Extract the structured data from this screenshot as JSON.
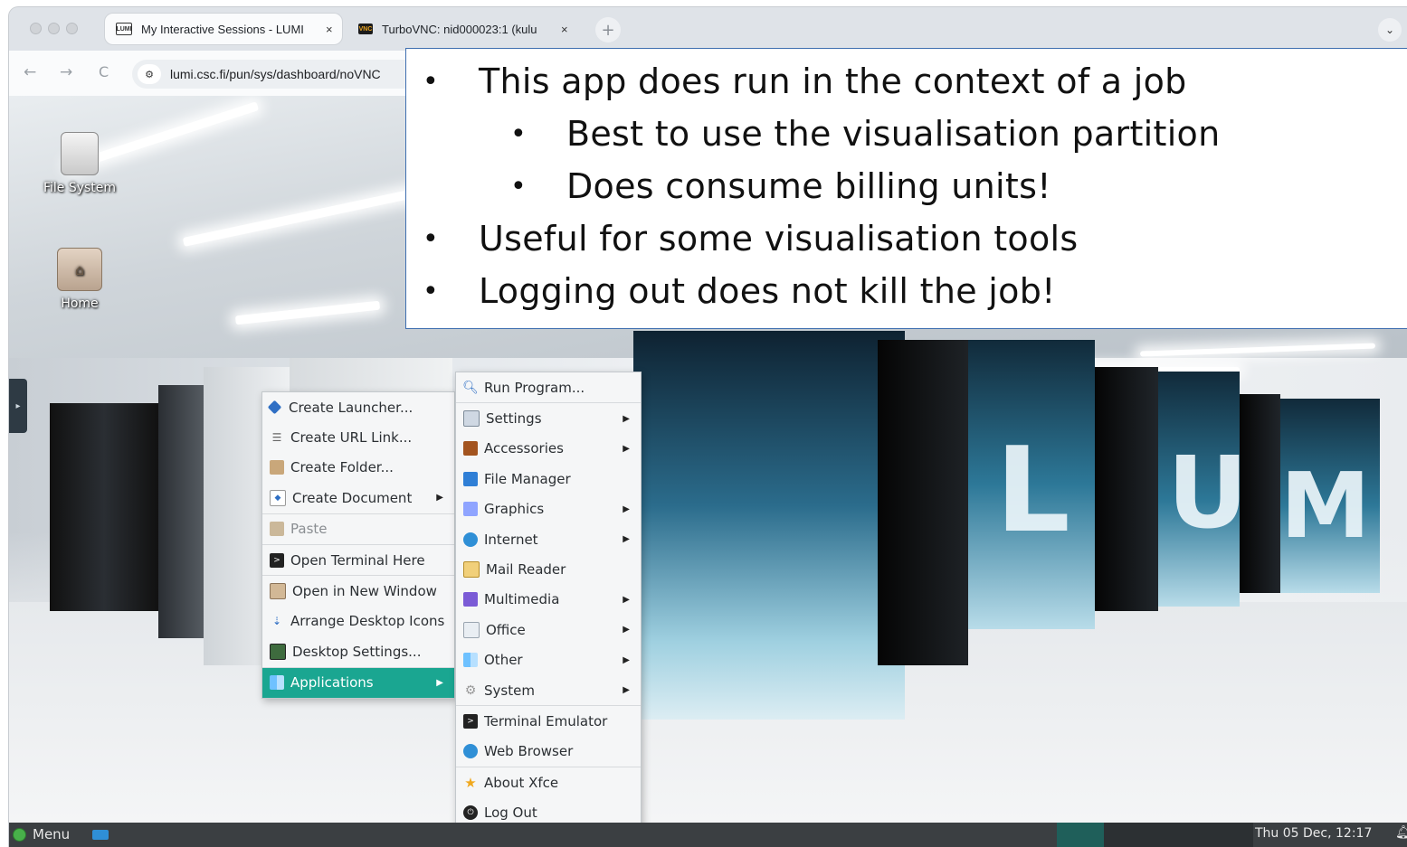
{
  "browser": {
    "tabs": [
      {
        "title": "My Interactive Sessions - LUMI",
        "favicon": "LUMI",
        "active": true
      },
      {
        "title": "TurboVNC: nid000023:1 (kulu",
        "favicon": "VNC",
        "active": false
      }
    ],
    "close_glyph": "×",
    "new_tab_glyph": "+",
    "tab_menu_glyph": "⌄",
    "nav": {
      "back": "←",
      "forward": "→",
      "reload": "C"
    },
    "url": "lumi.csc.fi/pun/sys/dashboard/noVNC"
  },
  "desktop": {
    "icons": [
      {
        "label": "File System",
        "icon": "drive-icon"
      },
      {
        "label": "Home",
        "icon": "home-folder-icon"
      }
    ],
    "wallpaper_letters": [
      "L",
      "U",
      "M"
    ]
  },
  "slide": {
    "bullets": [
      {
        "text": "This app does run in the context of a job",
        "level": 1
      },
      {
        "text": "Best to use the visualisation partition",
        "level": 2
      },
      {
        "text": "Does consume billing units!",
        "level": 2
      },
      {
        "text": "Useful for some visualisation tools",
        "level": 1
      },
      {
        "text": "Logging out does not kill the job!",
        "level": 1
      }
    ],
    "bullet_glyph": "•"
  },
  "context_menu": {
    "items": [
      {
        "label": "Create Launcher...",
        "icon": "launcher-icon",
        "submenu": false
      },
      {
        "label": "Create URL Link...",
        "icon": "link-icon",
        "submenu": false
      },
      {
        "label": "Create Folder...",
        "icon": "folder-new-icon",
        "submenu": false
      },
      {
        "label": "Create Document",
        "icon": "document-new-icon",
        "submenu": true
      },
      {
        "label": "Paste",
        "icon": "paste-icon",
        "submenu": false,
        "disabled": true
      },
      {
        "label": "Open Terminal Here",
        "icon": "terminal-icon",
        "submenu": false
      },
      {
        "label": "Open in New Window",
        "icon": "window-icon",
        "submenu": false
      },
      {
        "label": "Arrange Desktop Icons",
        "icon": "arrange-icon",
        "submenu": false
      },
      {
        "label": "Desktop Settings...",
        "icon": "desktop-settings-icon",
        "submenu": false
      },
      {
        "label": "Applications",
        "icon": "applications-icon",
        "submenu": true,
        "highlighted": true
      }
    ]
  },
  "applications_menu": {
    "items": [
      {
        "label": "Run Program...",
        "icon": "search-icon",
        "submenu": false
      },
      {
        "label": "Settings",
        "icon": "settings-icon",
        "submenu": true
      },
      {
        "label": "Accessories",
        "icon": "accessories-icon",
        "submenu": true
      },
      {
        "label": "File Manager",
        "icon": "file-manager-icon",
        "submenu": false
      },
      {
        "label": "Graphics",
        "icon": "graphics-icon",
        "submenu": true
      },
      {
        "label": "Internet",
        "icon": "internet-icon",
        "submenu": true
      },
      {
        "label": "Mail Reader",
        "icon": "mail-icon",
        "submenu": false
      },
      {
        "label": "Multimedia",
        "icon": "multimedia-icon",
        "submenu": true
      },
      {
        "label": "Office",
        "icon": "office-icon",
        "submenu": true
      },
      {
        "label": "Other",
        "icon": "other-icon",
        "submenu": true
      },
      {
        "label": "System",
        "icon": "system-icon",
        "submenu": true
      },
      {
        "label": "Terminal Emulator",
        "icon": "terminal-icon",
        "submenu": false
      },
      {
        "label": "Web Browser",
        "icon": "web-browser-icon",
        "submenu": false
      },
      {
        "label": "About Xfce",
        "icon": "about-icon",
        "submenu": false
      },
      {
        "label": "Log Out",
        "icon": "logout-icon",
        "submenu": false
      }
    ]
  },
  "taskbar": {
    "menu_label": "Menu",
    "clock": "Thu 05 Dec, 12:17"
  },
  "colors": {
    "highlight": "#1aa691",
    "taskbar": "#3b3f42",
    "slide_border": "#3f6fb0"
  }
}
